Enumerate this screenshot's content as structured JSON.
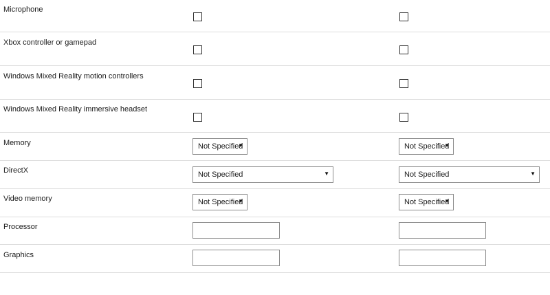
{
  "rows": [
    {
      "label": "Microphone",
      "type": "checkbox",
      "left_checked": false,
      "right_checked": false
    },
    {
      "label": "Xbox controller or gamepad",
      "type": "checkbox",
      "left_checked": false,
      "right_checked": false
    },
    {
      "label": "Windows Mixed Reality motion controllers",
      "type": "checkbox",
      "left_checked": false,
      "right_checked": false
    },
    {
      "label": "Windows Mixed Reality immersive headset",
      "type": "checkbox",
      "left_checked": false,
      "right_checked": false
    },
    {
      "label": "Memory",
      "type": "select",
      "left_value": "Not Specified",
      "right_value": "Not Specified"
    },
    {
      "label": "DirectX",
      "type": "select",
      "left_value": "Not Specified",
      "right_value": "Not Specified"
    },
    {
      "label": "Video memory",
      "type": "select",
      "left_value": "Not Specified",
      "right_value": "Not Specified"
    },
    {
      "label": "Processor",
      "type": "text",
      "left_value": "",
      "right_value": ""
    },
    {
      "label": "Graphics",
      "type": "text",
      "left_value": "",
      "right_value": ""
    }
  ],
  "icons": {
    "dropdown": "caret-down-icon"
  }
}
